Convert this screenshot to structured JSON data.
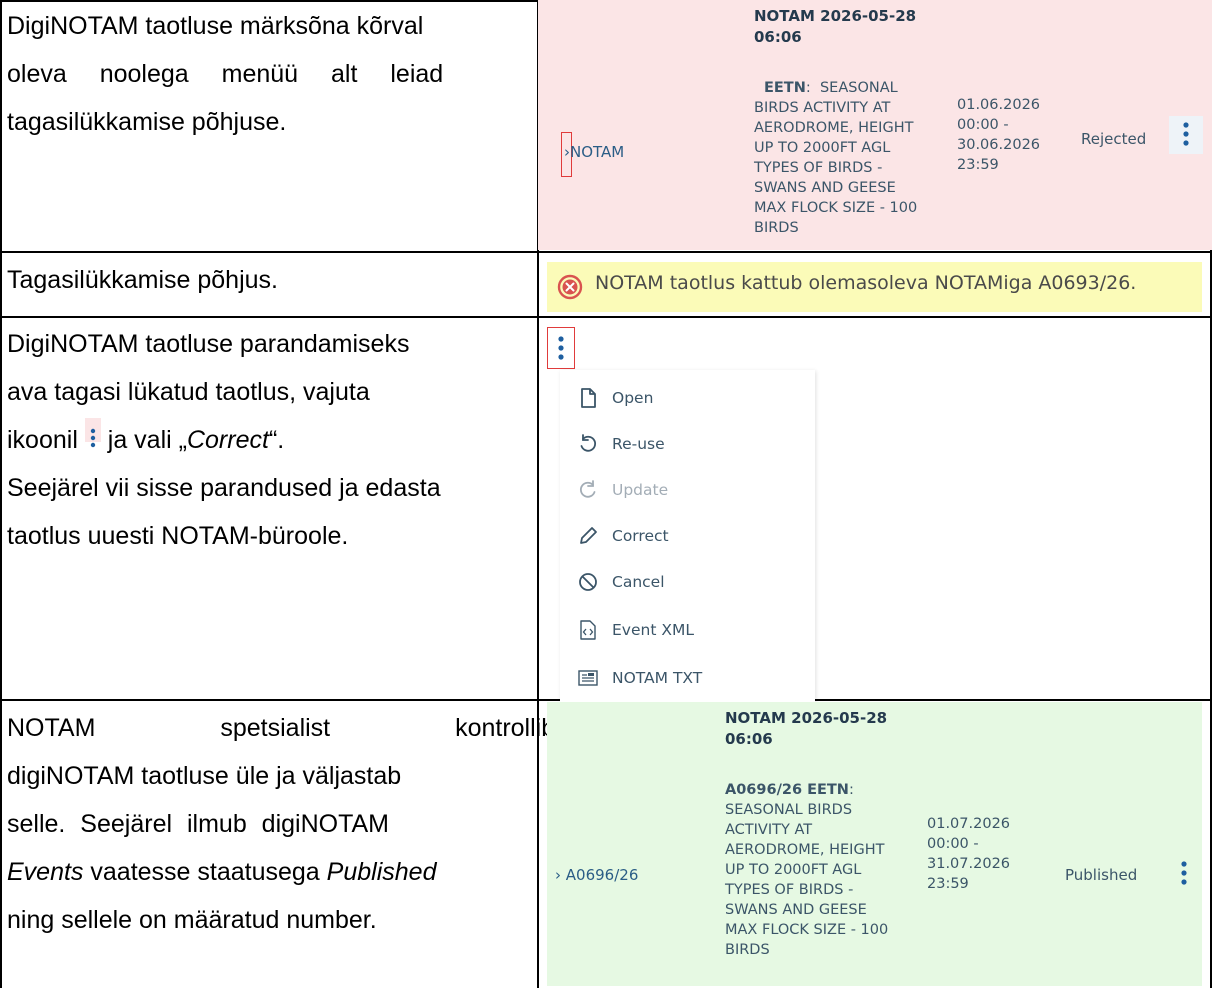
{
  "rows": [
    {
      "text_lines": [
        "DigiNOTAM taotluse märksõna kõrval",
        "oleva noolega menüü alt leiad",
        "tagasilükkamise põhjuse."
      ]
    },
    {
      "text_lines": [
        "Tagasilükkamise põhjus."
      ]
    },
    {
      "text_lines": [
        "DigiNOTAM taotluse parandamiseks",
        "ava tagasi lükatud taotlus, vajuta"
      ],
      "line3_before": "ikoonil",
      "line3_after": "ja vali „",
      "line3_italic": "Correct",
      "line3_end": "“.",
      "text_lines_after": [
        "Seejärel vii sisse parandused ja edasta",
        "taotlus uuesti NOTAM-büroole."
      ]
    },
    {
      "line1": "NOTAM spetsialist kontrollib",
      "line2": "digiNOTAM taotluse üle ja väljastab",
      "line3": "selle. Seejärel ilmub digiNOTAM",
      "line4_italic": "Events",
      "line4_mid": "vaatesse staatusega",
      "line4_italic2": "Published",
      "line5": "ning sellele on määratud number."
    }
  ],
  "rejected_row": {
    "link": "NOTAM",
    "header": [
      "NOTAM 2026-05-28",
      "06:06"
    ],
    "location": "EETN",
    "desc_first": "SEASONAL",
    "desc": [
      "BIRDS ACTIVITY AT",
      "AERODROME, HEIGHT",
      "UP TO 2000FT AGL",
      "TYPES OF BIRDS -",
      "SWANS AND GEESE",
      "MAX FLOCK SIZE - 100",
      "BIRDS"
    ],
    "dates": [
      "01.06.2026",
      "00:00 -",
      "30.06.2026",
      "23:59"
    ],
    "status": "Rejected",
    "bg": "#fbe5e6"
  },
  "warning": {
    "text": "NOTAM taotlus kattub olemasoleva NOTAMiga A0693/26.",
    "icon": "error-circle-icon",
    "bg": "#fbfbb8"
  },
  "menu": {
    "items": [
      {
        "label": "Open",
        "icon": "file-icon",
        "disabled": false
      },
      {
        "label": "Re-use",
        "icon": "undo-icon",
        "disabled": false
      },
      {
        "label": "Update",
        "icon": "refresh-icon",
        "disabled": true
      },
      {
        "label": "Correct",
        "icon": "pencil-icon",
        "disabled": false
      },
      {
        "label": "Cancel",
        "icon": "cancel-icon",
        "disabled": false
      },
      {
        "label": "Event XML",
        "icon": "xml-file-icon",
        "disabled": false
      },
      {
        "label": "NOTAM TXT",
        "icon": "text-file-icon",
        "disabled": false
      }
    ]
  },
  "published_row": {
    "link": "A0696/26",
    "header": [
      "NOTAM 2026-05-28",
      "06:06"
    ],
    "id_loc": "A0696/26 EETN",
    "desc": [
      "SEASONAL BIRDS",
      "ACTIVITY AT",
      "AERODROME, HEIGHT",
      "UP TO 2000FT AGL",
      "TYPES OF BIRDS -",
      "SWANS AND GEESE",
      "MAX FLOCK SIZE - 100",
      "BIRDS"
    ],
    "dates": [
      "01.07.2026",
      "00:00 -",
      "31.07.2026",
      "23:59"
    ],
    "status": "Published",
    "bg": "#e6f9e3"
  },
  "colors": {
    "accent": "#1e5fa0",
    "highlight": "#e03b3b"
  }
}
